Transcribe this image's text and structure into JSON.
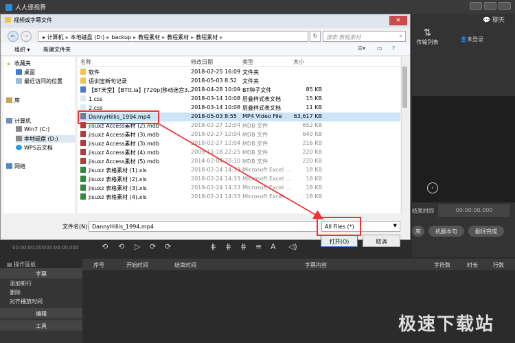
{
  "app": {
    "title": "人人译视界",
    "chat_label": "聊天",
    "transfer_label": "传输列表",
    "login_label": "未登录",
    "end_time_label": "结束时间",
    "end_time_value": "00:00:00,000",
    "buttons": [
      "库",
      "机翻本句",
      "翻译完成"
    ],
    "timecode": "00:00:00,000/00:00:00,000",
    "panel_title": "操作面板",
    "sidebar_sections": {
      "subtitle": "字幕",
      "edit": "编辑",
      "tools": "工具"
    },
    "sidebar_items": [
      "添加新行",
      "删除",
      "对齐播放时间"
    ],
    "columns": [
      "序号",
      "开始时间",
      "结束时间",
      "字幕内容",
      "字符数",
      "时长",
      "行数"
    ],
    "watermark": "极速下载站"
  },
  "dialog": {
    "title": "视频或字幕文件",
    "close": "✕",
    "breadcrumb": [
      "计算机",
      "本地磁盘 (D:)",
      "backup",
      "教程素材",
      "教程素材",
      "教程素材"
    ],
    "search_placeholder": "搜索 教程素材",
    "toolbar": {
      "organize": "组织 ▾",
      "new_folder": "新建文件夹"
    },
    "nav": [
      "收藏夹",
      "桌面",
      "最近访问的位置",
      "库",
      "计算机",
      "Win7 (C:)",
      "本地磁盘 (D:)",
      "WPS云文档",
      "网络"
    ],
    "headers": [
      "名称",
      "修改日期",
      "类型",
      "大小"
    ],
    "files": [
      {
        "name": "软件",
        "date": "2018-02-25 16:09",
        "type": "文件夹",
        "size": ""
      },
      {
        "name": "语训宝新句记录",
        "date": "2018-05-03 8:52",
        "type": "文件夹",
        "size": ""
      },
      {
        "name": "【BT天堂】【BTtt.la】[720p]移动迷宫3...",
        "date": "2018-04-28 10:09",
        "type": "BT种子文件",
        "size": "85 KB"
      },
      {
        "name": "1.css",
        "date": "2018-03-14 10:08",
        "type": "层叠样式表文档",
        "size": "15 KB"
      },
      {
        "name": "2.css",
        "date": "2018-03-14 10:08",
        "type": "层叠样式表文档",
        "size": "11 KB"
      },
      {
        "name": "DannyHillis_1994.mp4",
        "date": "2018-05-03 8:55",
        "type": "MP4 Video File",
        "size": "63,617 KB"
      },
      {
        "name": "jisuxz Access素材 (2).mdb",
        "date": "2018-02-27 12:04",
        "type": "MDB 文件",
        "size": "652 KB"
      },
      {
        "name": "jisuxz Access素材 (3).mdb",
        "date": "2018-02-27 12:04",
        "type": "MDB 文件",
        "size": "640 KB"
      },
      {
        "name": "jisuxz Access素材 (3).mdb",
        "date": "2018-02-27 12:04",
        "type": "MDB 文件",
        "size": "216 KB"
      },
      {
        "name": "jisuxz Access素材 (4).mdb",
        "date": "2009-11-18 22:25",
        "type": "MDB 文件",
        "size": "220 KB"
      },
      {
        "name": "jisuxz Access素材 (5).mdb",
        "date": "2014-02-04 20:10",
        "type": "MDB 文件",
        "size": "220 KB"
      },
      {
        "name": "jisuxz 表格素材 (1).xls",
        "date": "2018-02-24 14:33",
        "type": "Microsoft Excel ...",
        "size": "18 KB"
      },
      {
        "name": "jisuxz 表格素材 (2).xls",
        "date": "2018-02-24 14:33",
        "type": "Microsoft Excel ...",
        "size": "18 KB"
      },
      {
        "name": "jisuxz 表格素材 (3).xls",
        "date": "2018-02-24 14:33",
        "type": "Microsoft Excel ...",
        "size": "18 KB"
      },
      {
        "name": "jisuxz 表格素材 (4).xls",
        "date": "2018-02-24 14:33",
        "type": "Microsoft Excel ...",
        "size": "18 KB"
      }
    ],
    "filename_label": "文件名(N):",
    "filename_value": "DannyHillis_1994.mp4",
    "filetype_value": "All Files  (*)",
    "open_label": "打开(O)",
    "cancel_label": "取消"
  }
}
